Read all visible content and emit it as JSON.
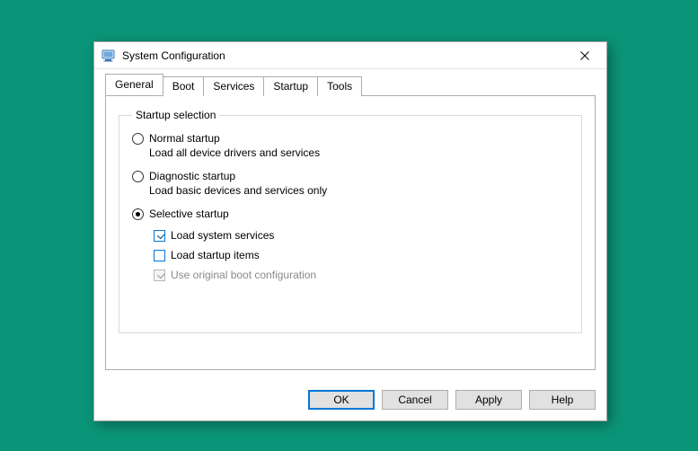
{
  "window": {
    "title": "System Configuration"
  },
  "tabs": {
    "general": "General",
    "boot": "Boot",
    "services": "Services",
    "startup": "Startup",
    "tools": "Tools"
  },
  "group": {
    "legend": "Startup selection",
    "normal": {
      "label": "Normal startup",
      "desc": "Load all device drivers and services"
    },
    "diagnostic": {
      "label": "Diagnostic startup",
      "desc": "Load basic devices and services only"
    },
    "selective": {
      "label": "Selective startup",
      "load_system": "Load system services",
      "load_startup": "Load startup items",
      "original_boot": "Use original boot configuration"
    }
  },
  "buttons": {
    "ok": "OK",
    "cancel": "Cancel",
    "apply": "Apply",
    "help": "Help"
  }
}
